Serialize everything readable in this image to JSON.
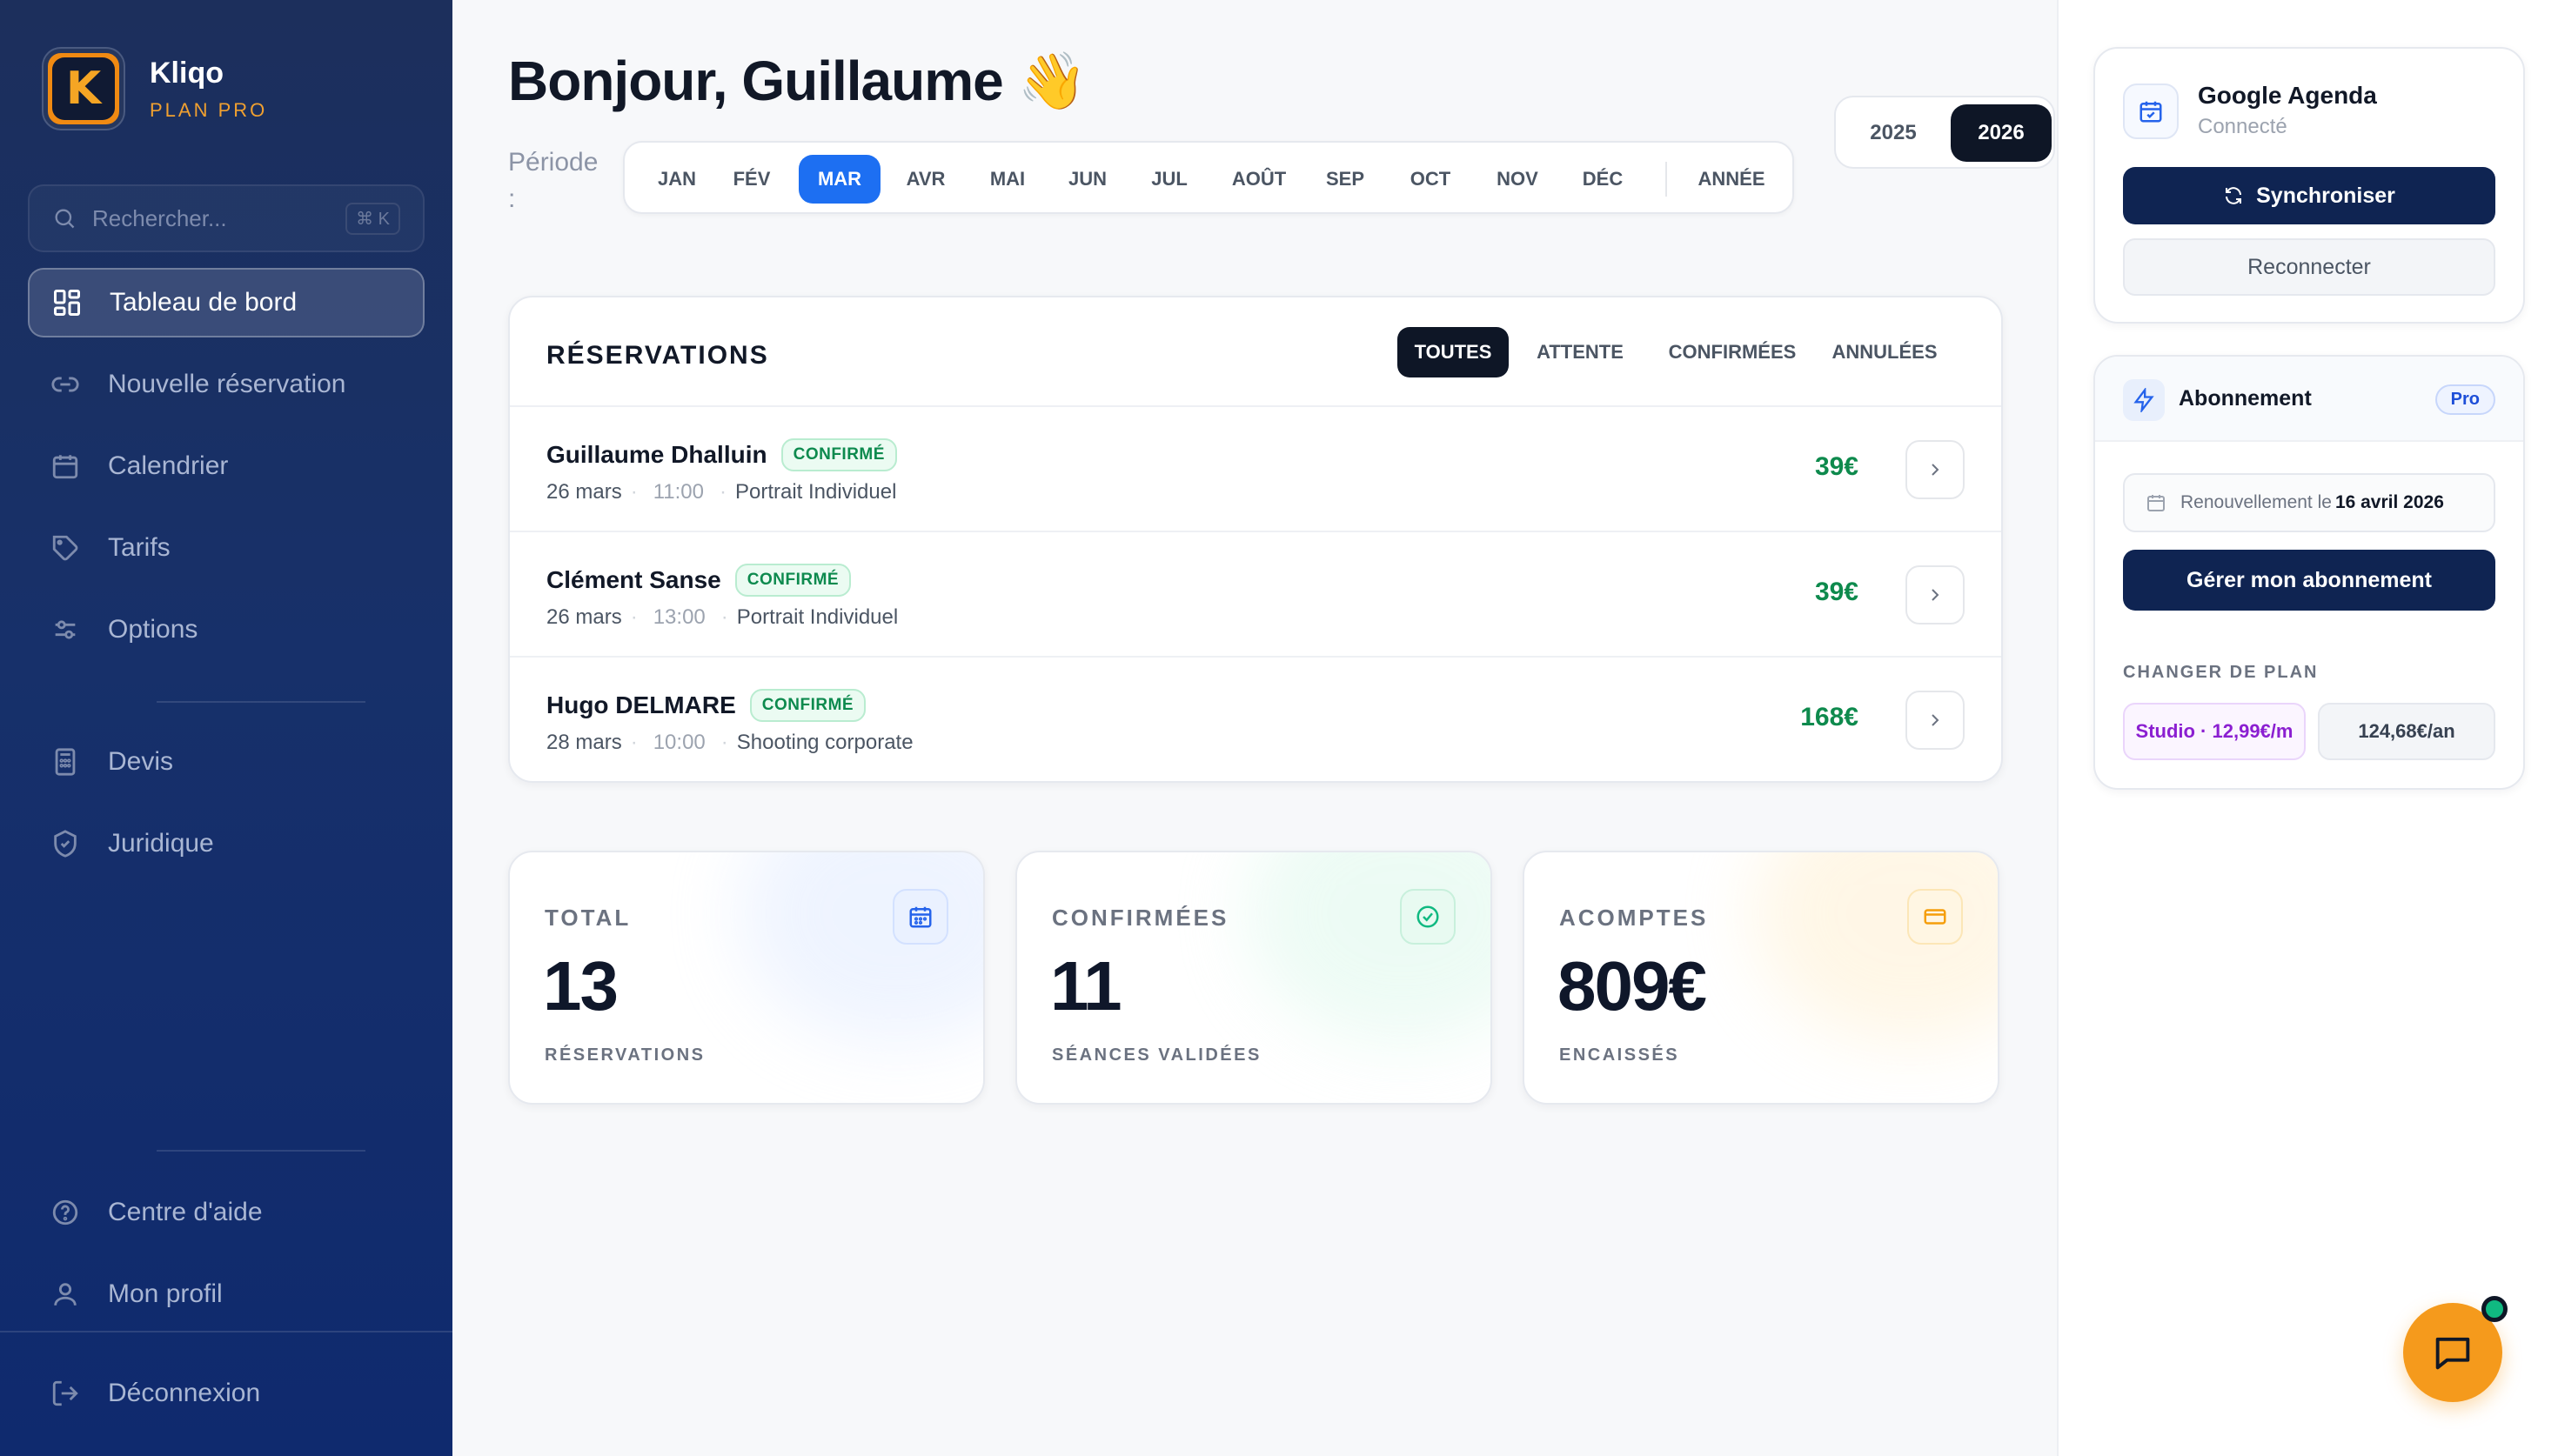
{
  "brand": {
    "name": "Kliqo",
    "plan": "PLAN PRO",
    "logo_letter": "K",
    "accent": "#f08a12"
  },
  "search": {
    "placeholder": "Rechercher...",
    "shortcut": "⌘ K"
  },
  "nav": {
    "dashboard": "Tableau de bord",
    "new_booking": "Nouvelle réservation",
    "calendar": "Calendrier",
    "pricing": "Tarifs",
    "options": "Options",
    "quotes": "Devis",
    "legal": "Juridique",
    "help": "Centre d'aide",
    "profile": "Mon profil",
    "logout": "Déconnexion"
  },
  "header": {
    "greeting": "Bonjour, Guillaume",
    "wave": "👋"
  },
  "period": {
    "label": "Période :",
    "months": [
      "JAN",
      "FÉV",
      "MAR",
      "AVR",
      "MAI",
      "JUN",
      "JUL",
      "AOÛT",
      "SEP",
      "OCT",
      "NOV",
      "DÉC"
    ],
    "active_month": "MAR",
    "year_label": "ANNÉE",
    "years": [
      "2025",
      "2026"
    ],
    "active_year": "2026"
  },
  "reservations": {
    "title": "RÉSERVATIONS",
    "filters": [
      "TOUTES",
      "ATTENTE",
      "CONFIRMÉES",
      "ANNULÉES"
    ],
    "active_filter": "TOUTES",
    "rows": [
      {
        "name": "Guillaume Dhalluin",
        "status": "CONFIRMÉ",
        "date": "26 mars",
        "time": "11:00",
        "type": "Portrait Individuel",
        "price": "39€"
      },
      {
        "name": "Clément Sanse",
        "status": "CONFIRMÉ",
        "date": "26 mars",
        "time": "13:00",
        "type": "Portrait Individuel",
        "price": "39€"
      },
      {
        "name": "Hugo DELMARE",
        "status": "CONFIRMÉ",
        "date": "28 mars",
        "time": "10:00",
        "type": "Shooting corporate",
        "price": "168€"
      }
    ]
  },
  "stats": [
    {
      "label": "TOTAL",
      "value": "13",
      "sub": "RÉSERVATIONS",
      "icon": "calendar-icon",
      "color": "#2563eb"
    },
    {
      "label": "CONFIRMÉES",
      "value": "11",
      "sub": "SÉANCES VALIDÉES",
      "icon": "check-circle-icon",
      "color": "#10b981"
    },
    {
      "label": "ACOMPTES",
      "value": "809€",
      "sub": "ENCAISSÉS",
      "icon": "credit-card-icon",
      "color": "#f59e0b"
    }
  ],
  "google_calendar": {
    "title": "Google Agenda",
    "status": "Connecté",
    "sync_label": "Synchroniser",
    "reconnect_label": "Reconnecter"
  },
  "subscription": {
    "title": "Abonnement",
    "badge": "Pro",
    "renewal_prefix": "Renouvellement le",
    "renewal_date": "16 avril 2026",
    "manage_label": "Gérer mon abonnement",
    "change_plan_label": "CHANGER DE PLAN",
    "plan_studio": "Studio · 12,99€/m",
    "plan_yearly": "124,68€/an"
  },
  "chat": {
    "icon": "chat-icon",
    "status_color": "#10b981"
  }
}
